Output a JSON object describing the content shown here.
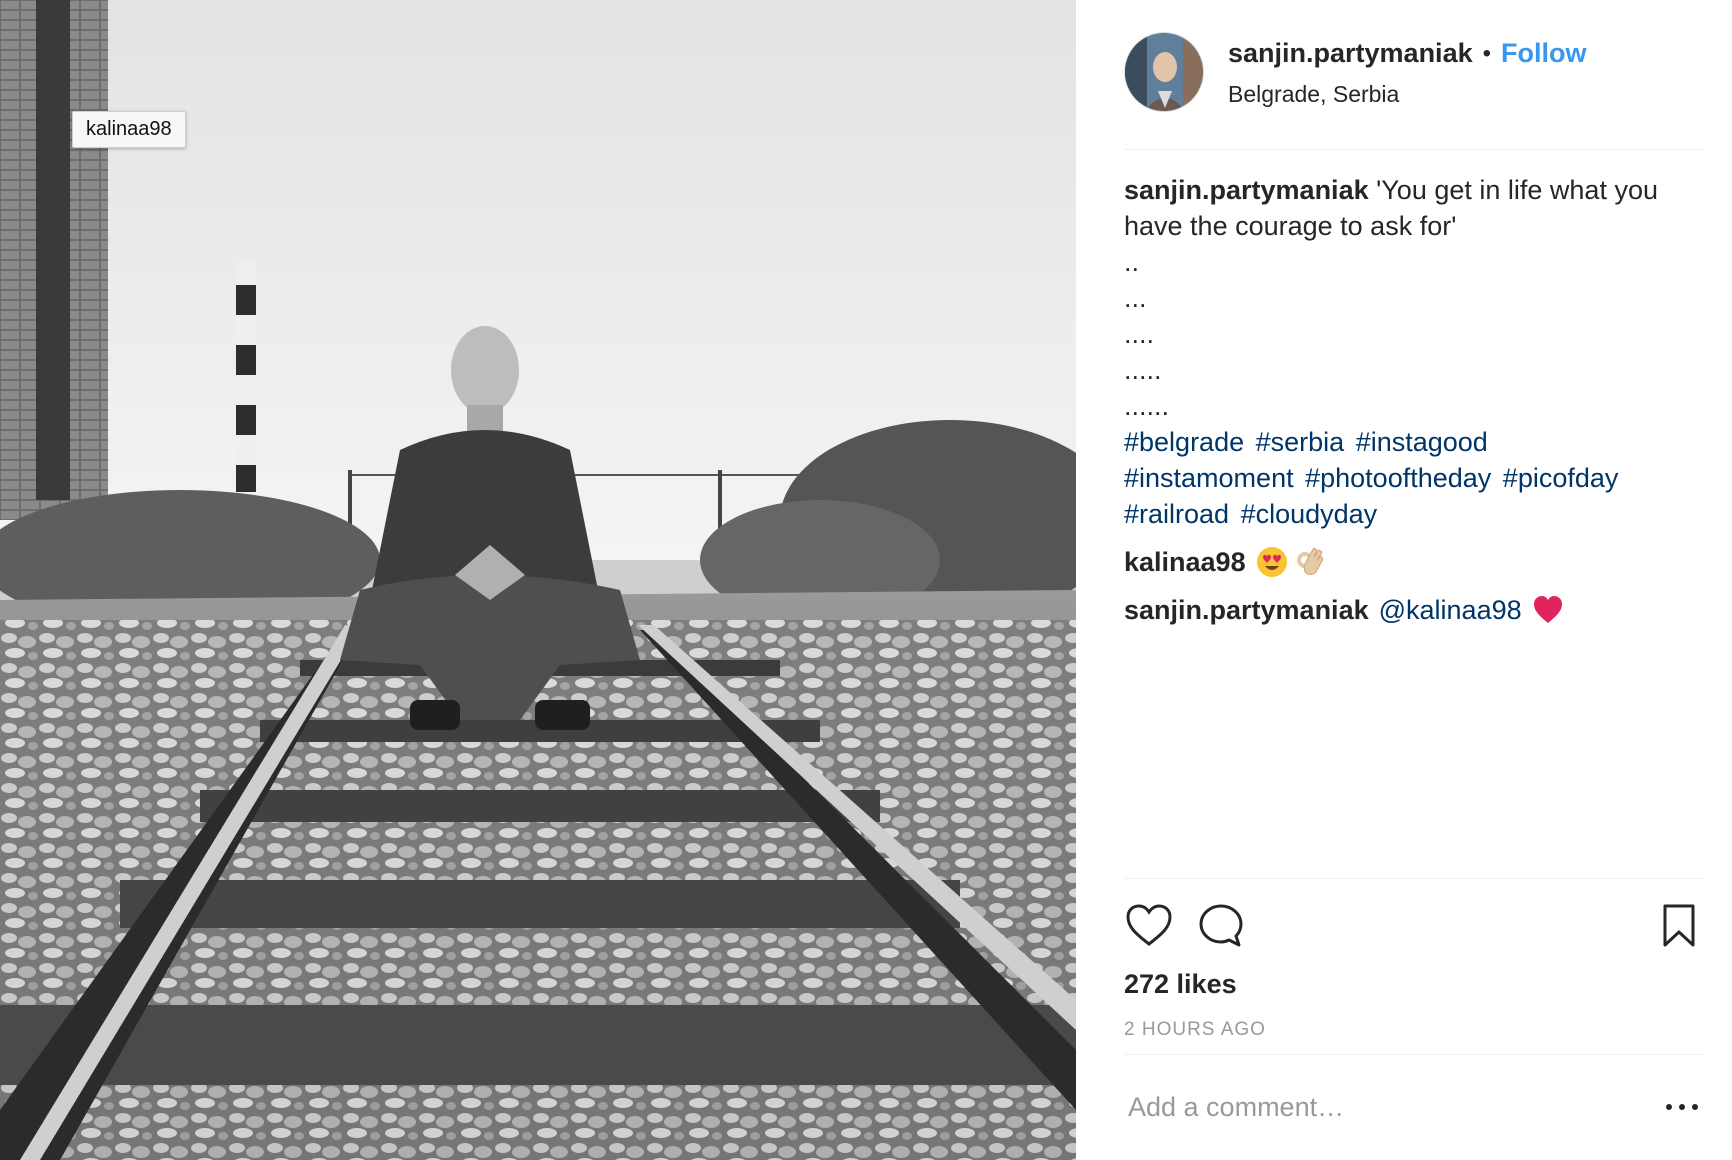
{
  "photo": {
    "tag_username": "kalinaa98",
    "description_icon": "photo-railroad"
  },
  "post_header": {
    "username": "sanjin.partymaniak",
    "separator": "•",
    "follow_label": "Follow",
    "location": "Belgrade, Serbia",
    "avatar_icon": "avatar-photo"
  },
  "caption": {
    "username": "sanjin.partymaniak",
    "text": "'You get in life what you have the courage to ask for'",
    "dot_lines": [
      "..",
      "...",
      "....",
      ".....",
      "......"
    ],
    "hashtags": [
      "#belgrade",
      "#serbia",
      "#instagood",
      "#instamoment",
      "#photooftheday",
      "#picofday",
      "#railroad",
      "#cloudyday"
    ]
  },
  "comments": [
    {
      "username": "kalinaa98",
      "emojis": [
        "heart-eyes-emoji",
        "ok-hand-emoji"
      ]
    },
    {
      "username": "sanjin.partymaniak",
      "mention": "@kalinaa98",
      "emojis": [
        "red-heart-emoji"
      ]
    }
  ],
  "actions": {
    "like_icon": "heart-outline-icon",
    "comment_icon": "comment-bubble-icon",
    "save_icon": "bookmark-icon",
    "likes_text": "272 likes",
    "time_text": "2 HOURS AGO"
  },
  "comment_form": {
    "placeholder": "Add a comment…",
    "more_icon": "more-options-icon"
  },
  "colors": {
    "follow_blue": "#3897f0",
    "hashtag_blue": "#003569",
    "muted_gray": "#999999",
    "heart_red": "#e0245e"
  }
}
